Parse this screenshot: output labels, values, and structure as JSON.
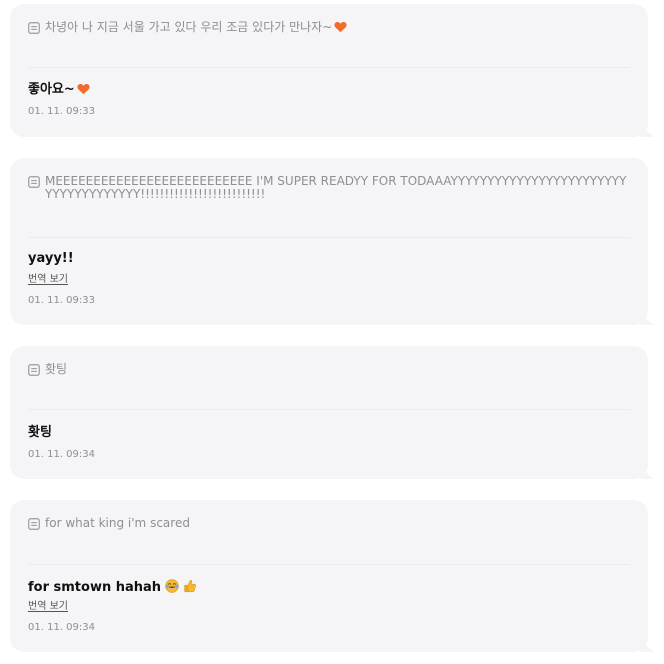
{
  "messages": [
    {
      "quote": "차녕아 나 지금 서울 가고 있다 우리 조금 있다가 만나자~",
      "reply": "좋아요~",
      "translate_label": "",
      "time": "01. 11. 09:33"
    },
    {
      "quote": "MEEEEEEEEEEEEEEEEEEEEEEEEEE I'M SUPER READYY FOR TODAAAYYYYYYYYYYYYYYYYYYYYYYYYYYYYYYYYYYYYY!!!!!!!!!!!!!!!!!!!!!!!!!!",
      "reply": "yayy!!",
      "translate_label": "번역 보기",
      "time": "01. 11. 09:33"
    },
    {
      "quote": "홧팅",
      "reply": "홧팅",
      "translate_label": "",
      "time": "01. 11. 09:34"
    },
    {
      "quote": "for what king i'm scared",
      "reply": "for smtown hahah",
      "translate_label": "번역 보기",
      "time": "01. 11. 09:34"
    }
  ],
  "colors": {
    "card_bg": "#f5f5f7",
    "heart": "#f26b2a",
    "muted_text": "#8e8e93"
  },
  "icons": {
    "quote": "document-lines-icon",
    "heart": "orange-heart-icon",
    "laugh": "tears-of-joy-emoji-icon",
    "thumbs_up": "thumbs-up-emoji-icon"
  }
}
